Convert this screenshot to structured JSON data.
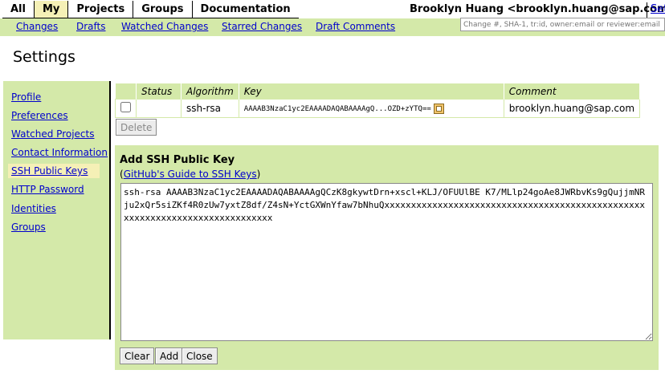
{
  "top_tabs": [
    "All",
    "My",
    "Projects",
    "Groups",
    "Documentation"
  ],
  "active_top_tab": "My",
  "user": {
    "display": "Brooklyn Huang <brooklyn.huang@sap.com>",
    "settings_link": "Set"
  },
  "sub_links": [
    "Changes",
    "Drafts",
    "Watched Changes",
    "Starred Changes",
    "Draft Comments"
  ],
  "search": {
    "placeholder": "Change #, SHA-1, tr:id, owner:email or reviewer:email"
  },
  "page_title": "Settings",
  "sidebar": {
    "items": [
      "Profile",
      "Preferences",
      "Watched Projects",
      "Contact Information",
      "SSH Public Keys",
      "HTTP Password",
      "Identities",
      "Groups"
    ],
    "active": "SSH Public Keys"
  },
  "keys_table": {
    "headers": [
      "",
      "Status",
      "Algorithm",
      "Key",
      "Comment"
    ],
    "rows": [
      {
        "status": "",
        "algorithm": "ssh-rsa",
        "key": "AAAAB3NzaC1yc2EAAAADAQABAAAAgQ...OZD+zYTQ==",
        "comment": "brooklyn.huang@sap.com"
      }
    ]
  },
  "delete_label": "Delete",
  "add_key": {
    "title": "Add SSH Public Key",
    "guide_open": "(",
    "guide_link": "GitHub's Guide to SSH Keys",
    "guide_close": ")",
    "textarea_value": "ssh-rsa AAAAB3NzaC1yc2EAAAADAQABAAAAgQCzK8gkywtDrn+xscl+KLJ/OFUUlBE K7/MLlp24goAe8JWRbvKs9gQujjmNRju2xQr5siZKf4R0zUw7yxtZ8df/Z4sN+YctGXWnYfaw7bNhuQxxxxxxxxxxxxxxxxxxxxxxxxxxxxxxxxxxxxxxxxxxxxxxxxxxxxxxxxxxxxxxxxxxxxxxxxxxxxx",
    "clear_label": "Clear",
    "add_label": "Add",
    "close_label": "Close"
  }
}
